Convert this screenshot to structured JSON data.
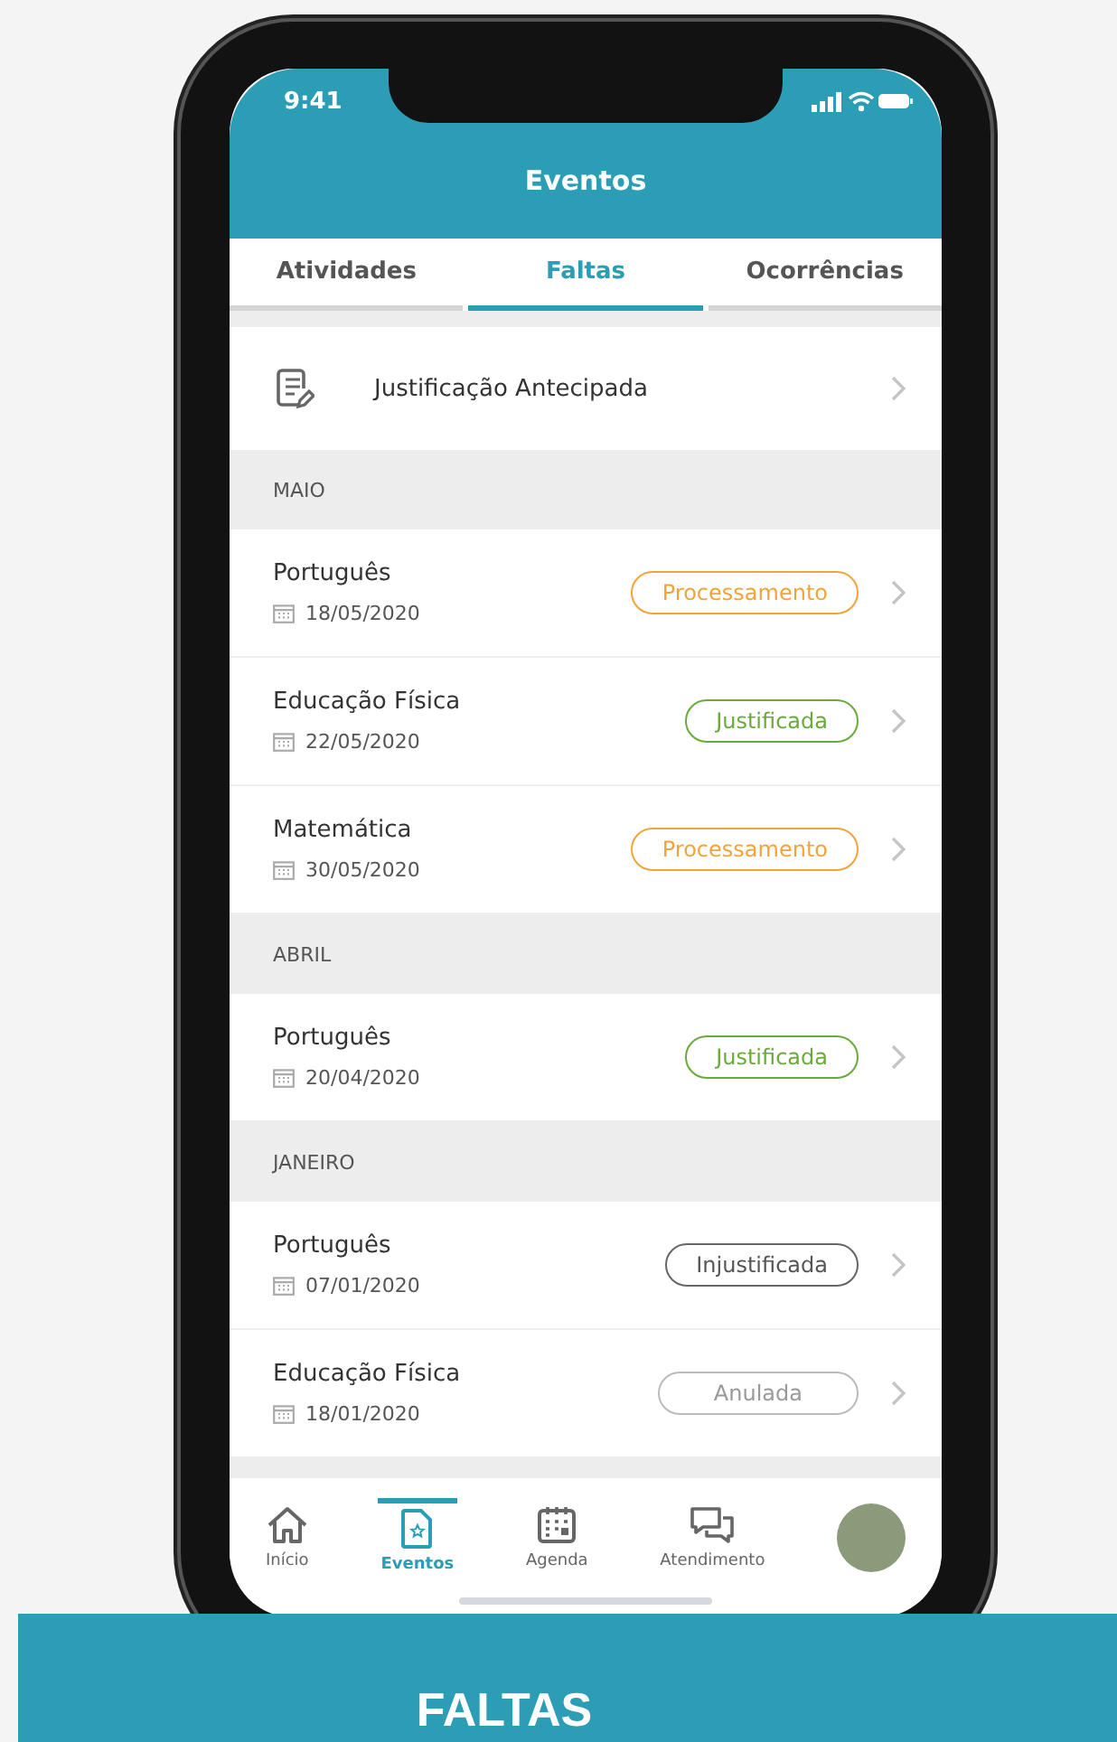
{
  "status_bar": {
    "time": "9:41"
  },
  "header": {
    "title": "Eventos"
  },
  "tabs": [
    {
      "label": "Atividades",
      "selected": false
    },
    {
      "label": "Faltas",
      "selected": true
    },
    {
      "label": "Ocorrências",
      "selected": false
    }
  ],
  "action": {
    "label": "Justificação Antecipada"
  },
  "sections": [
    {
      "title": "MAIO",
      "items": [
        {
          "subject": "Português",
          "date": "18/05/2020",
          "status": "Processamento",
          "kind": "processing"
        },
        {
          "subject": "Educação Física",
          "date": "22/05/2020",
          "status": "Justificada",
          "kind": "justified"
        },
        {
          "subject": "Matemática",
          "date": "30/05/2020",
          "status": "Processamento",
          "kind": "processing"
        }
      ]
    },
    {
      "title": "ABRIL",
      "items": [
        {
          "subject": "Português",
          "date": "20/04/2020",
          "status": "Justificada",
          "kind": "justified"
        }
      ]
    },
    {
      "title": "JANEIRO",
      "items": [
        {
          "subject": "Português",
          "date": "07/01/2020",
          "status": "Injustificada",
          "kind": "unjustified"
        },
        {
          "subject": "Educação Física",
          "date": "18/01/2020",
          "status": "Anulada",
          "kind": "annulled"
        }
      ]
    }
  ],
  "nav": [
    {
      "label": "Início",
      "kind": "home",
      "selected": false
    },
    {
      "label": "Eventos",
      "kind": "doc",
      "selected": true
    },
    {
      "label": "Agenda",
      "kind": "calendar",
      "selected": false
    },
    {
      "label": "Atendimento",
      "kind": "chat",
      "selected": false
    },
    {
      "kind": "avatar",
      "selected": false
    }
  ],
  "banner": {
    "title": "FALTAS"
  }
}
